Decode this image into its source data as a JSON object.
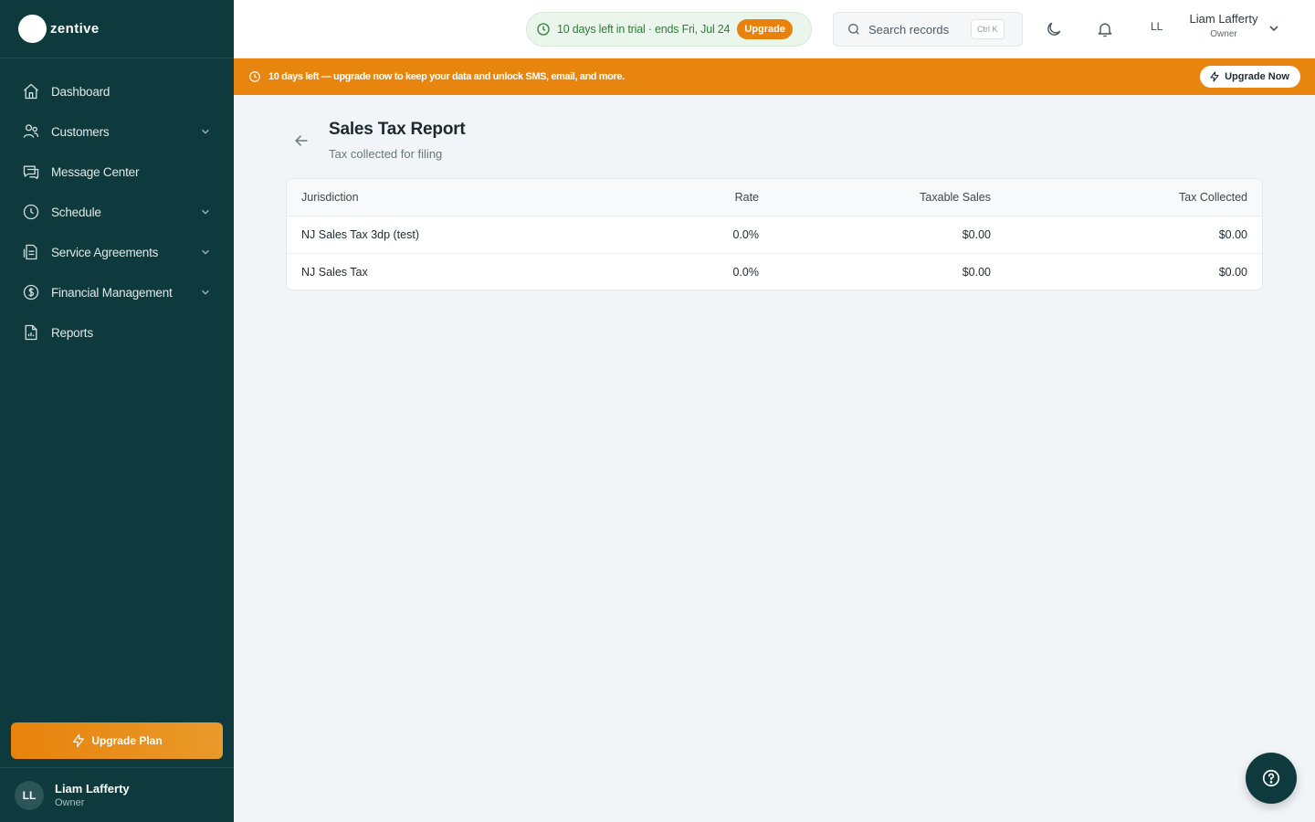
{
  "brand": {
    "name": "zentive"
  },
  "sidebar": {
    "items": [
      {
        "label": "Dashboard",
        "icon": "home-icon",
        "has_submenu": false
      },
      {
        "label": "Customers",
        "icon": "users-icon",
        "has_submenu": true
      },
      {
        "label": "Message Center",
        "icon": "message-icon",
        "has_submenu": false
      },
      {
        "label": "Schedule",
        "icon": "clock-icon",
        "has_submenu": true
      },
      {
        "label": "Service Agreements",
        "icon": "agreement-icon",
        "has_submenu": true
      },
      {
        "label": "Financial Management",
        "icon": "dollar-icon",
        "has_submenu": true
      },
      {
        "label": "Reports",
        "icon": "report-icon",
        "has_submenu": false
      }
    ],
    "upgrade_label": "Upgrade Plan",
    "user": {
      "initials": "LL",
      "name": "Liam Lafferty",
      "role": "Owner"
    }
  },
  "header": {
    "trial_text": "10 days left in trial · ends Fri, Jul 24",
    "trial_upgrade_label": "Upgrade",
    "search_placeholder": "Search records",
    "search_shortcut": "Ctrl K",
    "user_initials": "LL",
    "user_name": "Liam Lafferty",
    "user_role": "Owner"
  },
  "banner": {
    "text": "10 days left — upgrade now to keep your data and unlock SMS, email, and more.",
    "button_label": "Upgrade Now"
  },
  "page": {
    "title": "Sales Tax Report",
    "subtitle": "Tax collected for filing"
  },
  "table": {
    "headers": {
      "jurisdiction": "Jurisdiction",
      "rate": "Rate",
      "taxable_sales": "Taxable Sales",
      "tax_collected": "Tax Collected"
    },
    "rows": [
      {
        "jurisdiction": "NJ Sales Tax 3dp (test)",
        "rate": "0.0%",
        "taxable_sales": "$0.00",
        "tax_collected": "$0.00"
      },
      {
        "jurisdiction": "NJ Sales Tax",
        "rate": "0.0%",
        "taxable_sales": "$0.00",
        "tax_collected": "$0.00"
      }
    ]
  },
  "colors": {
    "sidebar_bg": "#0f3a3d",
    "accent_orange": "#e8850e",
    "trial_green": "#2e7d3a",
    "page_bg": "#f1f5f8"
  }
}
